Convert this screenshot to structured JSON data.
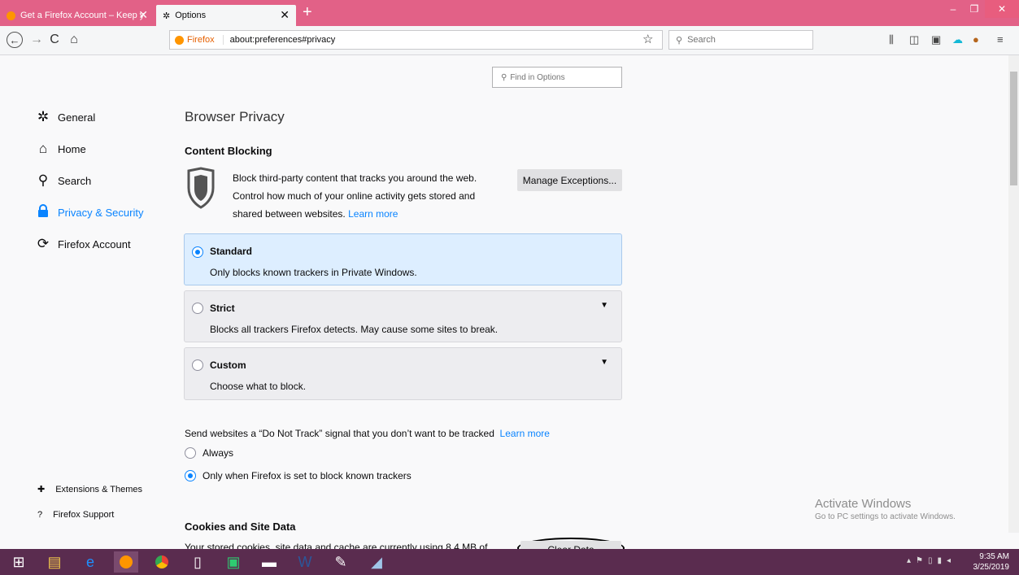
{
  "tabs": [
    {
      "title": "Get a Firefox Account – Keep y",
      "close": "✕"
    },
    {
      "title": "Options",
      "close": "✕"
    }
  ],
  "new_tab": "+",
  "window_controls": {
    "minimize": "–",
    "maximize": "❐",
    "close": "✕"
  },
  "nav": {
    "back": "←",
    "forward": "→",
    "reload": "C",
    "home": "⌂"
  },
  "url": {
    "identity": "Firefox",
    "address": "about:preferences#privacy"
  },
  "bookmark_star": "☆",
  "search": {
    "placeholder": "Search"
  },
  "find_in_options": {
    "placeholder": "Find in Options"
  },
  "sidebar": {
    "items": [
      {
        "label": "General",
        "icon": "gear-icon"
      },
      {
        "label": "Home",
        "icon": "home-icon"
      },
      {
        "label": "Search",
        "icon": "search-icon"
      },
      {
        "label": "Privacy & Security",
        "icon": "lock-icon"
      },
      {
        "label": "Firefox Account",
        "icon": "sync-icon"
      }
    ],
    "footer": [
      {
        "label": "Extensions & Themes",
        "icon": "puzzle-icon"
      },
      {
        "label": "Firefox Support",
        "icon": "help-icon"
      }
    ]
  },
  "main": {
    "title": "Browser Privacy",
    "content_blocking": {
      "heading": "Content Blocking",
      "line1": "Block third-party content that tracks you around the web.",
      "line2": "Control how much of your online activity gets stored and",
      "line3": "shared between websites.",
      "learn_more": "Learn more",
      "manage_button": "Manage Exceptions...",
      "options": [
        {
          "title": "Standard",
          "desc": "Only blocks known trackers in Private Windows.",
          "selected": true
        },
        {
          "title": "Strict",
          "desc": "Blocks all trackers Firefox detects. May cause some sites to break.",
          "selected": false
        },
        {
          "title": "Custom",
          "desc": "Choose what to block.",
          "selected": false
        }
      ]
    },
    "dnt": {
      "text": "Send websites a “Do Not Track” signal that you don’t want to be tracked",
      "learn_more": "Learn more",
      "always": "Always",
      "only_when": "Only when Firefox is set to block known trackers",
      "selected": "only_when"
    },
    "cookies": {
      "heading": "Cookies and Site Data",
      "text": "Your stored cookies, site data and cache are currently using 8.4 MB of",
      "clear_button": "Clear Data"
    }
  },
  "watermark": {
    "title": "Activate Windows",
    "subtitle": "Go to PC settings to activate Windows."
  },
  "taskbar": {
    "time": "9:35 AM",
    "date": "3/25/2019"
  },
  "colors": {
    "tabbar": "#e26187",
    "accent": "#0a84ff",
    "taskbar": "#5a2c4f"
  }
}
